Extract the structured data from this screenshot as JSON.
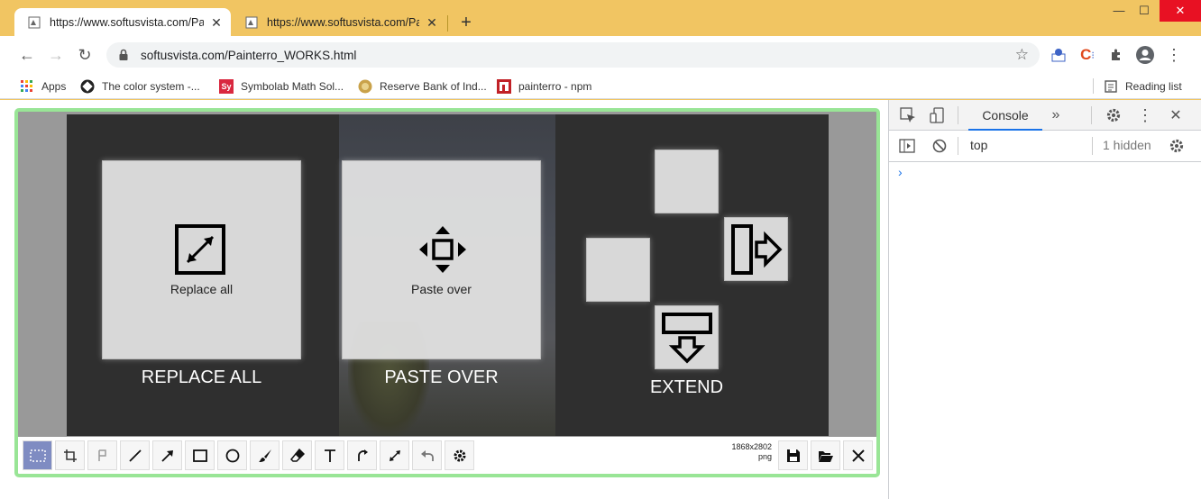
{
  "tabs": [
    {
      "title": "https://www.softusvista.com/Painterro_WORKS.html",
      "active": true
    },
    {
      "title": "https://www.softusvista.com/Painterro_WORKS.html",
      "active": false
    }
  ],
  "window": {
    "minimize": "—",
    "maximize": "☐",
    "close": "✕"
  },
  "address": {
    "url": "softusvista.com/Painterro_WORKS.html"
  },
  "bookmarks": [
    {
      "label": "Apps"
    },
    {
      "label": "The color system -..."
    },
    {
      "label": "Symbolab Math Sol..."
    },
    {
      "label": "Reserve Bank of Ind..."
    },
    {
      "label": "painterro - npm"
    }
  ],
  "reading_list": "Reading list",
  "painterro": {
    "replace_all": {
      "panel_label": "Replace all",
      "big_label": "REPLACE ALL"
    },
    "paste_over": {
      "panel_label": "Paste over",
      "big_label": "PASTE OVER"
    },
    "extend": {
      "big_label": "EXTEND"
    },
    "tools": [
      "select",
      "crop",
      "pixelize",
      "line",
      "arrow",
      "rect",
      "ellipse",
      "brush",
      "eraser",
      "text",
      "rotate",
      "resize",
      "undo",
      "settings"
    ],
    "image_size": "1868x2802",
    "image_format": "png"
  },
  "devtools": {
    "tab": "Console",
    "context": "top",
    "hidden": "1 hidden",
    "prompt": "›"
  }
}
